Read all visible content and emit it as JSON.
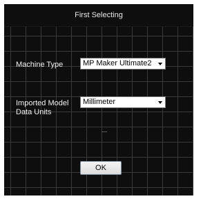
{
  "window": {
    "title": "First Selecting"
  },
  "machine": {
    "label": "Machine Type",
    "value": "MP Maker Ultimate2"
  },
  "units": {
    "label_line1": "Imported Model",
    "label_line2": "Data Units",
    "value": "Millimeter"
  },
  "buttons": {
    "ok_label": "OK"
  }
}
